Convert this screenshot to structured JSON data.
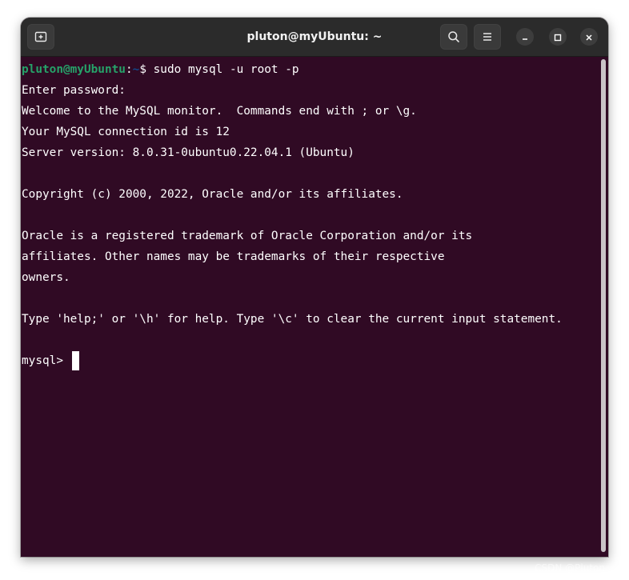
{
  "window": {
    "title": "pluton@myUbuntu: ~",
    "background": "#300a24",
    "titlebar_background": "#2b2b2b"
  },
  "titlebar": {
    "new_tab_icon": "new-tab-icon",
    "search_icon": "search-icon",
    "menu_icon": "hamburger-menu-icon",
    "minimize_icon": "minimize-icon",
    "maximize_icon": "maximize-icon",
    "close_icon": "close-icon"
  },
  "terminal": {
    "prompt": {
      "user_host": "pluton@myUbuntu",
      "separator": ":",
      "path": "~",
      "symbol": "$ ",
      "command": "sudo mysql -u root -p",
      "user_color": "#26a269",
      "path_color": "#12488b"
    },
    "output_lines": [
      "Enter password:",
      "Welcome to the MySQL monitor.  Commands end with ; or \\g.",
      "Your MySQL connection id is 12",
      "Server version: 8.0.31-0ubuntu0.22.04.1 (Ubuntu)",
      "",
      "Copyright (c) 2000, 2022, Oracle and/or its affiliates.",
      "",
      "Oracle is a registered trademark of Oracle Corporation and/or its",
      "affiliates. Other names may be trademarks of their respective",
      "owners.",
      "",
      "Type 'help;' or '\\h' for help. Type '\\c' to clear the current input statement.",
      ""
    ],
    "mysql_prompt": "mysql> "
  },
  "watermark": "CSDN @Pluton"
}
